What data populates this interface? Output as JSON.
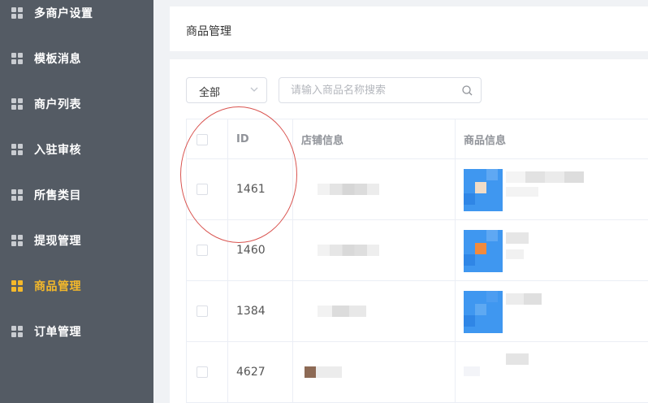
{
  "sidebar": {
    "items": [
      {
        "label": "多商户设置",
        "active": false
      },
      {
        "label": "模板消息",
        "active": false
      },
      {
        "label": "商户列表",
        "active": false
      },
      {
        "label": "入驻审核",
        "active": false
      },
      {
        "label": "所售类目",
        "active": false
      },
      {
        "label": "提现管理",
        "active": false
      },
      {
        "label": "商品管理",
        "active": true
      },
      {
        "label": "订单管理",
        "active": false
      }
    ],
    "active_color": "#f5b92a"
  },
  "header": {
    "title": "商品管理"
  },
  "filters": {
    "status_select": {
      "value": "全部"
    },
    "search": {
      "placeholder": "请输入商品名称搜索",
      "value": ""
    }
  },
  "table": {
    "columns": [
      "",
      "ID",
      "店铺信息",
      "商品信息"
    ],
    "rows": [
      {
        "id": "1461"
      },
      {
        "id": "1460"
      },
      {
        "id": "1384"
      },
      {
        "id": "4627"
      }
    ]
  }
}
